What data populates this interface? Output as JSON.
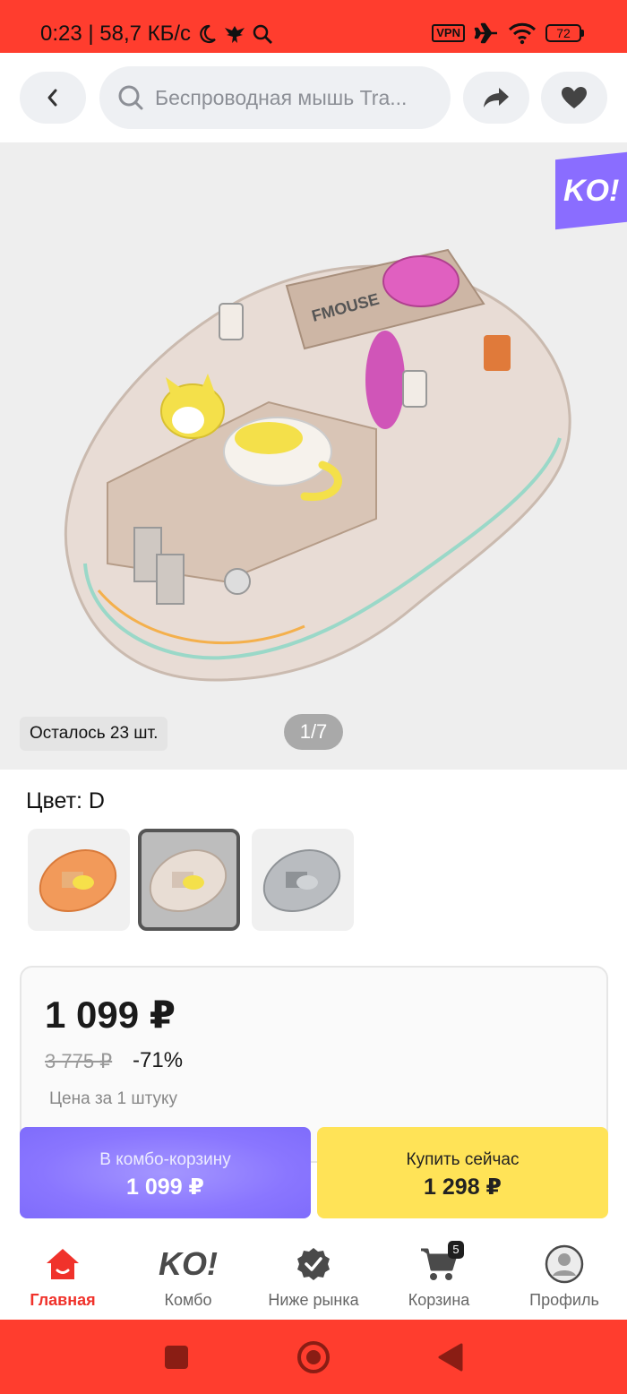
{
  "status_bar": {
    "time_speed": "0:23 | 58,7 КБ/с",
    "vpn": "VPN",
    "battery": "72"
  },
  "top_bar": {
    "search_text": "Беспроводная мышь Tra..."
  },
  "gallery": {
    "badge": "KO!",
    "stock": "Осталось 23 шт.",
    "counter": "1/7",
    "mouse_logo": "FMOUSE"
  },
  "color": {
    "label": "Цвет: D",
    "selected_index": 1,
    "swatches": [
      "orange",
      "beige",
      "gray"
    ]
  },
  "price": {
    "current": "1 099 ₽",
    "old": "3 775 ₽",
    "discount": "-71%",
    "unit_note": "Цена за 1 штуку"
  },
  "actions": {
    "combo_label": "В комбо-корзину",
    "combo_price": "1 099 ₽",
    "buy_label": "Купить сейчас",
    "buy_price": "1 298 ₽"
  },
  "nav": {
    "items": [
      {
        "label": "Главная",
        "icon": "home-icon"
      },
      {
        "label": "Комбо",
        "icon": "ko-logo-icon"
      },
      {
        "label": "Ниже рынка",
        "icon": "verified-badge-icon"
      },
      {
        "label": "Корзина",
        "icon": "cart-icon"
      },
      {
        "label": "Профиль",
        "icon": "profile-icon"
      }
    ],
    "cart_count": "5",
    "ko_text": "KO!"
  },
  "colors": {
    "system_red": "#ff3d2e",
    "active_red": "#f0322b",
    "combo_purple": "#8a76ff",
    "buy_yellow": "#ffe357"
  }
}
